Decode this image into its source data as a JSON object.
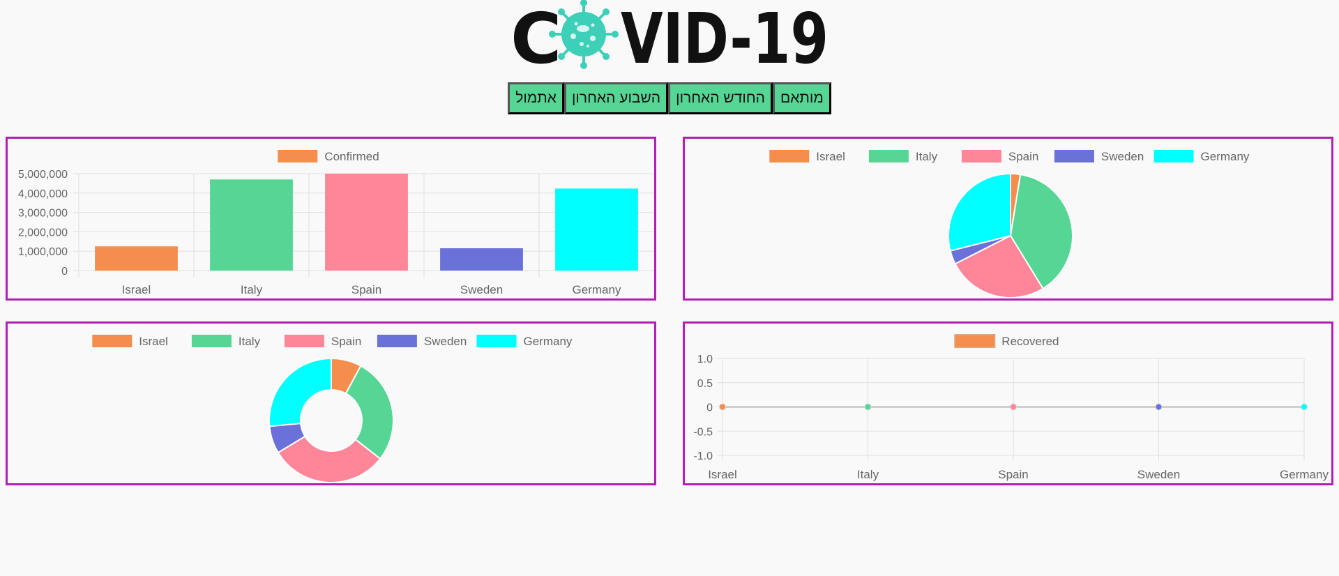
{
  "header": {
    "logo_text": "COVID-19"
  },
  "nav": {
    "buttons": [
      "מותאם",
      "החודש האחרון",
      "השבוע האחרון",
      "אתמול"
    ]
  },
  "colors": {
    "Israel": "#f58d4d",
    "Italy": "#56d694",
    "Spain": "#ff8599",
    "Sweden": "#6a71d8",
    "Germany": "#00ffff",
    "panel_border": "#b31fb5",
    "nav_button": "#55d694"
  },
  "chart_data": [
    {
      "type": "bar",
      "legend": [
        "Confirmed"
      ],
      "categories": [
        "Israel",
        "Italy",
        "Spain",
        "Sweden",
        "Germany"
      ],
      "series": [
        {
          "name": "Confirmed",
          "values": [
            1250000,
            4700000,
            5000000,
            1150000,
            4230000
          ]
        }
      ],
      "yticks": [
        "5,000,000",
        "4,000,000",
        "3,000,000",
        "2,000,000",
        "1,000,000",
        "0"
      ],
      "ylim": [
        0,
        5000000
      ],
      "grid": true,
      "legend_position": "top"
    },
    {
      "type": "pie",
      "legend": [
        "Israel",
        "Italy",
        "Spain",
        "Sweden",
        "Germany"
      ],
      "values": [
        1250000,
        19000000,
        12900000,
        1750000,
        14200000
      ],
      "legend_position": "top"
    },
    {
      "type": "pie",
      "variant": "doughnut",
      "legend": [
        "Israel",
        "Italy",
        "Spain",
        "Sweden",
        "Germany"
      ],
      "values": [
        3.3,
        11.6,
        12.9,
        3.0,
        11.1
      ],
      "legend_position": "top"
    },
    {
      "type": "line",
      "legend": [
        "Recovered"
      ],
      "categories": [
        "Israel",
        "Italy",
        "Spain",
        "Sweden",
        "Germany"
      ],
      "series": [
        {
          "name": "Recovered",
          "values": [
            0,
            0,
            0,
            0,
            0
          ]
        }
      ],
      "yticks": [
        "1.0",
        "0.5",
        "0",
        "-0.5",
        "-1.0"
      ],
      "ylim": [
        -1,
        1
      ],
      "grid": true,
      "legend_position": "top"
    }
  ]
}
